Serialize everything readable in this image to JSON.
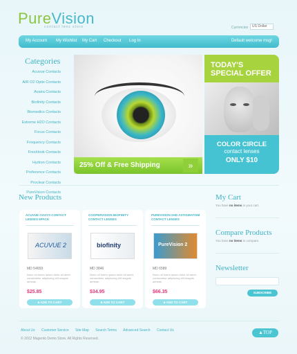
{
  "brand": {
    "name_part1": "Pure",
    "name_part2": "Vision",
    "tagline": "contact lens store"
  },
  "currency": {
    "label": "Currencies",
    "selected": "US Dollar"
  },
  "nav": {
    "items": [
      "My Account",
      "My Wishlist",
      "My Cart",
      "Checkout",
      "Log In"
    ],
    "welcome": "Default welcome msg!"
  },
  "categories": {
    "title": "Categories",
    "items": [
      "Acuvue Contacts",
      "AIR O2 Optix Contacts",
      "Avaira Contacts",
      "Biofinity Contacts",
      "Biomedics Contacts",
      "Extreme H2O Contacts",
      "Focus Contacts",
      "Frequency Contacts",
      "Freshlook Contacts",
      "Hydron Contacts",
      "Preference Contacts",
      "Proclear Contacts",
      "PureVision Contacts"
    ]
  },
  "banner": {
    "shipping_text": "25% Off & Free Shipping",
    "arrow": "»"
  },
  "special_offer": {
    "title_line1": "TODAY'S",
    "title_line2": "SPECIAL OFFER",
    "line1": "COLOR CIRCLE",
    "line2": "contact lenses",
    "line3": "ONLY $10"
  },
  "new_products": {
    "title": "New Products",
    "items": [
      {
        "name": "ACUVUE OASYS CONTACT LENSES 6PACK",
        "box_label": "ACUVUE 2",
        "id": "MD 54659",
        "desc": "Nunc mi lorem ipsum dolor sit amet, consectetur adipiscing elit magnis aenean",
        "price": "$25.85",
        "button": "ADD TO CART"
      },
      {
        "name": "COOPERVISION BIOFINITY CONTACT LENSES",
        "box_label": "biofinity",
        "id": "MD 3846",
        "desc": "Nunc mi lorem ipsum dolor sit amet, consectetur adipiscing elit magnis aenean",
        "price": "$34.95",
        "button": "ADD TO CART"
      },
      {
        "name": "PUREVISION 2HD ASTIGMATISM CONTACT LENSES",
        "box_label": "PureVision 2",
        "id": "MD 6589",
        "desc": "Nunc mi lorem ipsum dolor sit amet, consectetur adipiscing elit magnis aenean",
        "price": "$66.35",
        "button": "ADD TO CART"
      }
    ]
  },
  "sidebar": {
    "cart": {
      "title": "My Cart",
      "text_pre": "You have ",
      "text_bold": "no items",
      "text_post": " in your cart."
    },
    "compare": {
      "title": "Compare Products",
      "text_pre": "You have ",
      "text_bold": "no items",
      "text_post": " to compare."
    },
    "newsletter": {
      "title": "Newsletter",
      "button": "SUBSCRIBE"
    }
  },
  "footer": {
    "links": [
      "About Us",
      "Customer Service",
      "Site Map",
      "Search Terms",
      "Advanced Search",
      "Contact Us"
    ],
    "copyright": "© 2012 Magento Demo Store. All Rights Reserved.",
    "top_button": "TOP"
  },
  "colors": {
    "accent": "#48b8c8",
    "green": "#8cc63f",
    "price": "#e3387a"
  }
}
